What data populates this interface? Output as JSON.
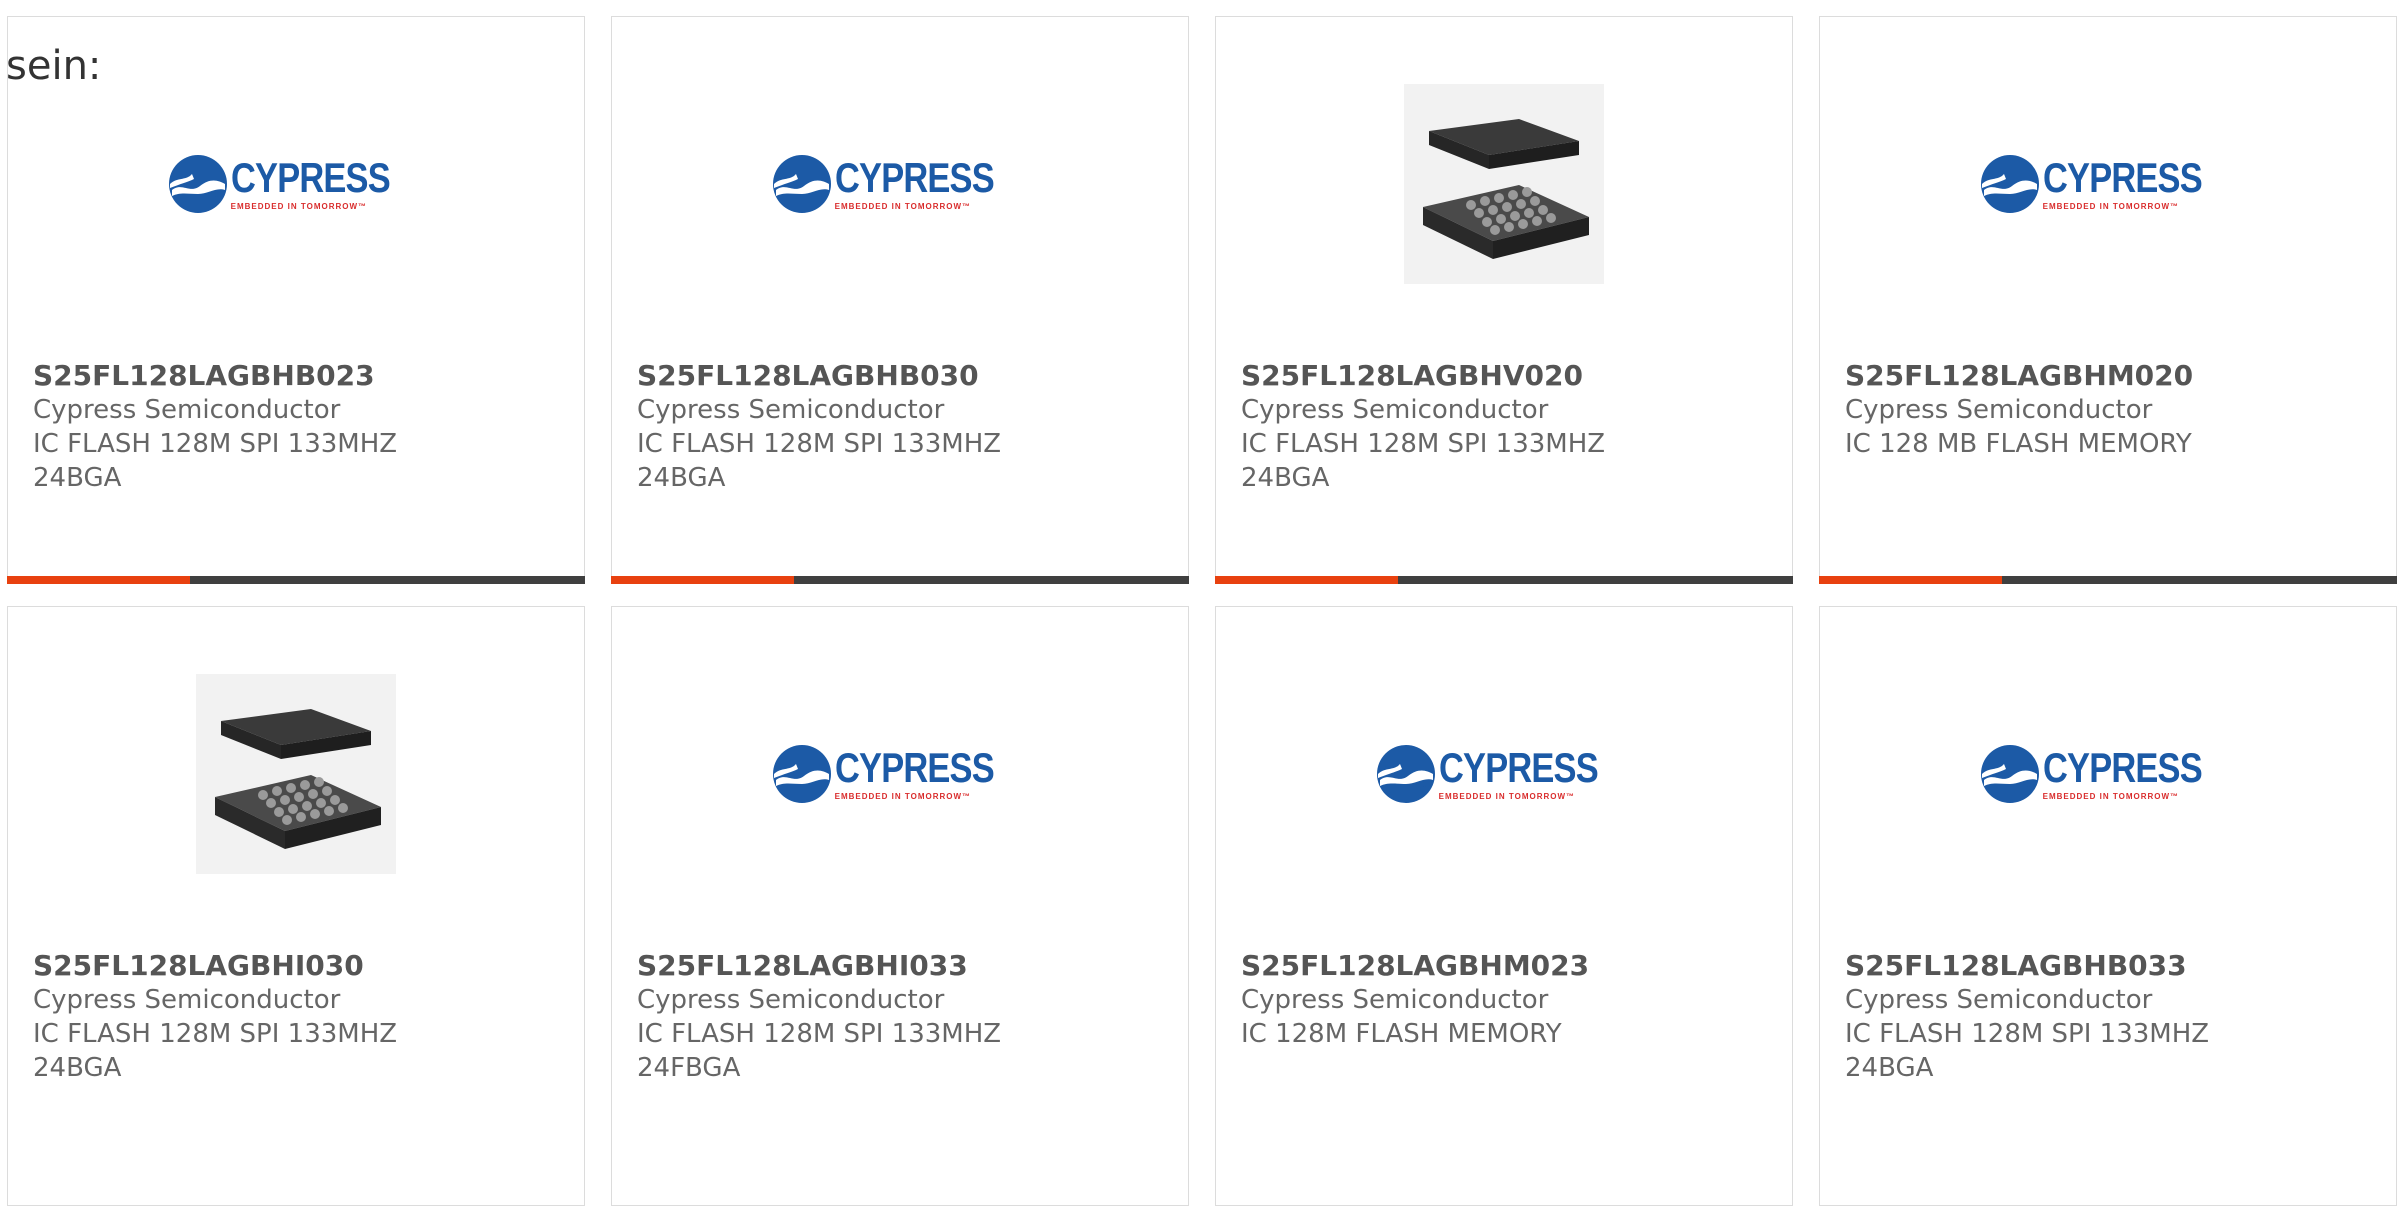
{
  "intro_text": "sein:",
  "logo": {
    "word": "CYPRESS",
    "tagline": "EMBEDDED IN TOMORROW™",
    "colors": {
      "blue": "#1c5aa6",
      "red": "#d92d2d"
    }
  },
  "colors": {
    "accent": "#e8410f",
    "bar": "#3f3f3f",
    "border": "#dcdcdc"
  },
  "products": [
    {
      "part": "S25FL128LAGBHB023",
      "manufacturer": "Cypress Semiconductor",
      "desc1": "IC FLASH 128M SPI 133MHZ",
      "desc2": "24BGA",
      "image": "cypress-logo-icon"
    },
    {
      "part": "S25FL128LAGBHB030",
      "manufacturer": "Cypress Semiconductor",
      "desc1": "IC FLASH 128M SPI 133MHZ",
      "desc2": "24BGA",
      "image": "cypress-logo-icon"
    },
    {
      "part": "S25FL128LAGBHV020",
      "manufacturer": "Cypress Semiconductor",
      "desc1": "IC FLASH 128M SPI 133MHZ",
      "desc2": "24BGA",
      "image": "bga-chip-icon"
    },
    {
      "part": "S25FL128LAGBHM020",
      "manufacturer": "Cypress Semiconductor",
      "desc1": "IC 128 MB FLASH MEMORY",
      "desc2": "",
      "image": "cypress-logo-icon"
    },
    {
      "part": "S25FL128LAGBHI030",
      "manufacturer": "Cypress Semiconductor",
      "desc1": "IC FLASH 128M SPI 133MHZ",
      "desc2": "24BGA",
      "image": "bga-chip-icon"
    },
    {
      "part": "S25FL128LAGBHI033",
      "manufacturer": "Cypress Semiconductor",
      "desc1": "IC FLASH 128M SPI 133MHZ",
      "desc2": "24FBGA",
      "image": "cypress-logo-icon"
    },
    {
      "part": "S25FL128LAGBHM023",
      "manufacturer": "Cypress Semiconductor",
      "desc1": "IC 128M FLASH MEMORY",
      "desc2": "",
      "image": "cypress-logo-icon"
    },
    {
      "part": "S25FL128LAGBHB033",
      "manufacturer": "Cypress Semiconductor",
      "desc1": "IC FLASH 128M SPI 133MHZ",
      "desc2": "24BGA",
      "image": "cypress-logo-icon"
    }
  ]
}
